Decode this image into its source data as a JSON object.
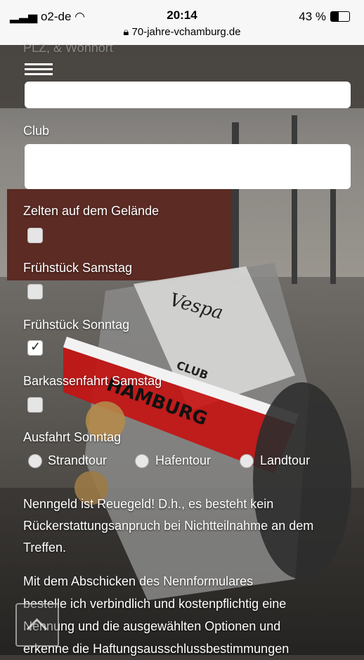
{
  "status_bar": {
    "carrier": "o2-de",
    "time": "20:14",
    "battery": "43 %",
    "url": "70-jahre-vchamburg.de"
  },
  "form": {
    "partial_label": "PLZ, & Wohnort",
    "club_label": "Club",
    "club_value": "",
    "camping_label": "Zelten auf dem Gelände",
    "breakfast_sat_label": "Frühstück Samstag",
    "breakfast_sun_label": "Frühstück Sonntag",
    "boat_trip_label": "Barkassenfahrt Samstag",
    "ride_label": "Ausfahrt Sonntag",
    "ride_options": [
      "Strandtour",
      "Hafentour",
      "Landtour"
    ],
    "checkbox_states": {
      "camping": false,
      "breakfast_sat": false,
      "breakfast_sun": true,
      "boat_trip": false
    }
  },
  "text": {
    "fee_notice": "Nenngeld ist Reuegeld! D.h., es besteht kein Rückerstattungsanpruch bei Nichtteilnahme an dem Treffen.",
    "terms_line1": "Mit dem Abschicken des Nennformulares",
    "terms_line2": "bestelle ich verbindlich und kostenpflichtig eine",
    "terms_line3": "Nennung und die ausgewählten Optionen und",
    "terms_line4": "erkenne die Haftungsausschlussbestimmungen"
  },
  "background": {
    "scooter_text": "Vespa",
    "club_text": "CLUB",
    "city_text": "HAMBURG"
  },
  "icons": {
    "menu": "hamburger-menu-icon",
    "lock": "lock-icon",
    "scroll_up": "chevron-up-icon"
  }
}
